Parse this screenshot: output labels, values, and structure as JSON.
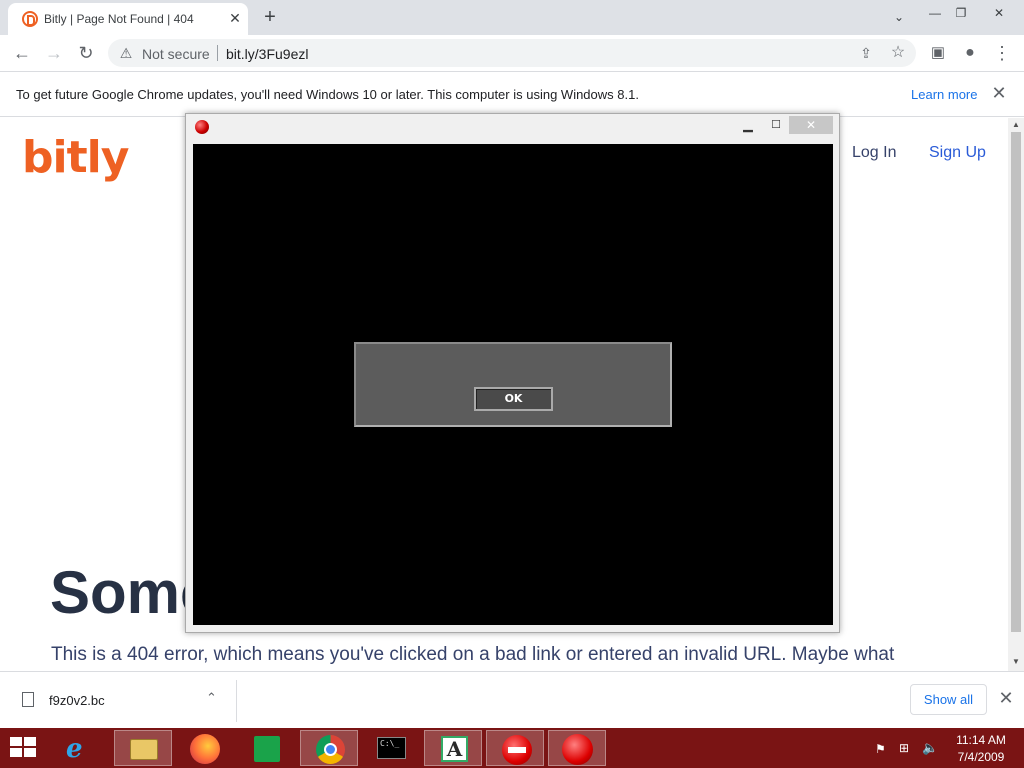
{
  "browser": {
    "tab": {
      "title": "Bitly | Page Not Found | 404",
      "close_glyph": "✕"
    },
    "new_tab_glyph": "+",
    "tab_search_glyph": "⌄",
    "window_controls": {
      "minimize": "—",
      "restore": "❐",
      "close": "✕"
    },
    "nav": {
      "back": "←",
      "forward": "→",
      "reload": "↻"
    },
    "omnibox": {
      "security_icon": "warning-icon",
      "security_glyph": "⚠",
      "security_label": "Not secure",
      "url": "bit.ly/3Fu9ezl"
    },
    "toolbar_right": {
      "share_glyph": "⇪",
      "star_glyph": "☆",
      "sidebar_glyph": "▣",
      "profile_glyph": "●",
      "menu_glyph": "⋮"
    },
    "infobar": {
      "message": "To get future Google Chrome updates, you'll need Windows 10 or later. This computer is using Windows 8.1.",
      "link": "Learn more",
      "close_glyph": "✕"
    }
  },
  "page": {
    "logo": "bitly",
    "nav": {
      "login": "Log In",
      "signup": "Sign Up"
    },
    "headline": "Some",
    "description": "This is a 404 error, which means you've clicked on a bad link or entered an invalid URL. Maybe what"
  },
  "scrollbar": {
    "up_glyph": "▲",
    "down_glyph": "▼"
  },
  "overlay_window": {
    "min_glyph": "▁",
    "max_glyph": "☐",
    "close_glyph": "✕",
    "dialog": {
      "ok_label": "OK"
    }
  },
  "download_shelf": {
    "file_name": "f9z0v2.bc",
    "chevron_glyph": "⌃",
    "show_all": "Show all",
    "close_glyph": "✕"
  },
  "taskbar": {
    "cmd_text": "C:\\_",
    "font_letter": "A",
    "tray": {
      "flag_glyph": "⚑",
      "network_glyph": "⊞",
      "volume_glyph": "🔈"
    },
    "clock": {
      "time": "11:14 AM",
      "date": "7/4/2009"
    }
  },
  "colors": {
    "bitly_orange": "#ee6123",
    "taskbar": "#7a1414",
    "link_blue": "#1a73e8"
  }
}
